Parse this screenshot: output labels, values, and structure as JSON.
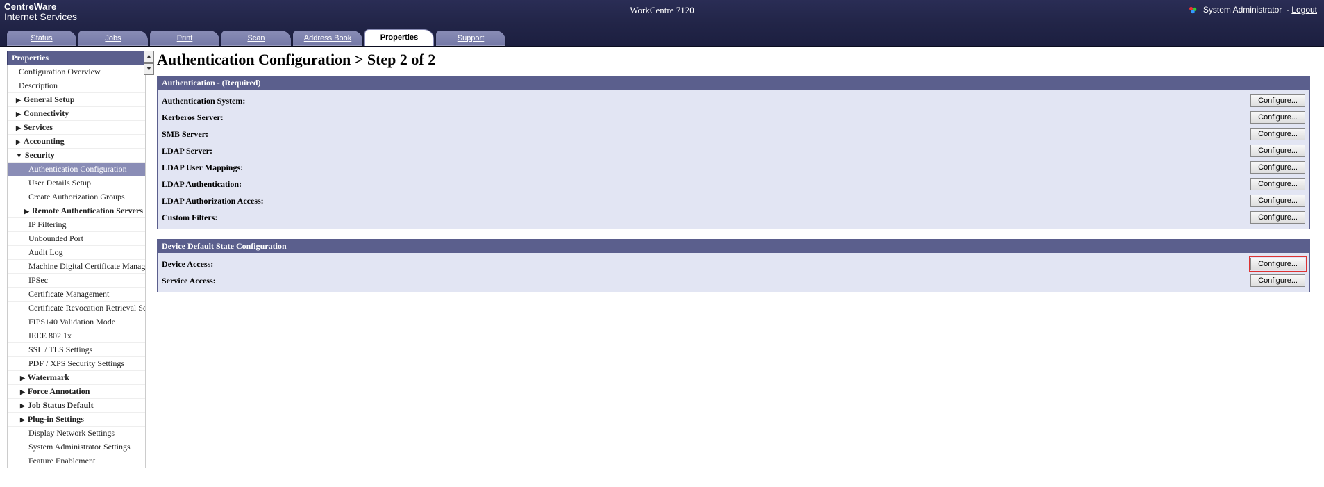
{
  "header": {
    "brand_top": "CentreWare",
    "brand_bottom": "Internet Services",
    "model": "WorkCentre 7120",
    "user_label": "System Administrator",
    "logout_label": "Logout"
  },
  "tabs": [
    {
      "label": "Status",
      "active": false
    },
    {
      "label": "Jobs",
      "active": false
    },
    {
      "label": "Print",
      "active": false
    },
    {
      "label": "Scan",
      "active": false
    },
    {
      "label": "Address Book",
      "active": false
    },
    {
      "label": "Properties",
      "active": true
    },
    {
      "label": "Support",
      "active": false
    }
  ],
  "sidebar": {
    "title": "Properties",
    "items": [
      {
        "label": "Configuration Overview",
        "type": "item"
      },
      {
        "label": "Description",
        "type": "item"
      },
      {
        "label": "General Setup",
        "type": "group",
        "open": false
      },
      {
        "label": "Connectivity",
        "type": "group",
        "open": false
      },
      {
        "label": "Services",
        "type": "group",
        "open": false
      },
      {
        "label": "Accounting",
        "type": "group",
        "open": false
      },
      {
        "label": "Security",
        "type": "group",
        "open": true
      },
      {
        "label": "Authentication Configuration",
        "type": "sub",
        "selected": true
      },
      {
        "label": "User Details Setup",
        "type": "sub"
      },
      {
        "label": "Create Authorization Groups",
        "type": "sub"
      },
      {
        "label": "Remote Authentication Servers",
        "type": "sub-group",
        "open": false
      },
      {
        "label": "IP Filtering",
        "type": "sub"
      },
      {
        "label": "Unbounded Port",
        "type": "sub"
      },
      {
        "label": "Audit Log",
        "type": "sub"
      },
      {
        "label": "Machine Digital Certificate Management",
        "type": "sub"
      },
      {
        "label": "IPSec",
        "type": "sub"
      },
      {
        "label": "Certificate Management",
        "type": "sub"
      },
      {
        "label": "Certificate Revocation Retrieval Settings",
        "type": "sub"
      },
      {
        "label": "FIPS140 Validation Mode",
        "type": "sub"
      },
      {
        "label": "IEEE 802.1x",
        "type": "sub"
      },
      {
        "label": "SSL / TLS Settings",
        "type": "sub"
      },
      {
        "label": "PDF / XPS Security Settings",
        "type": "sub"
      },
      {
        "label": "Watermark",
        "type": "group",
        "open": false,
        "indent": true
      },
      {
        "label": "Force Annotation",
        "type": "group",
        "open": false,
        "indent": true
      },
      {
        "label": "Job Status Default",
        "type": "group",
        "open": false,
        "indent": true
      },
      {
        "label": "Plug-in Settings",
        "type": "group",
        "open": false,
        "indent": true
      },
      {
        "label": "Display Network Settings",
        "type": "sub"
      },
      {
        "label": "System Administrator Settings",
        "type": "sub"
      },
      {
        "label": "Feature Enablement",
        "type": "sub"
      }
    ]
  },
  "main": {
    "title": "Authentication Configuration > Step 2 of 2",
    "configure_label": "Configure...",
    "panel1": {
      "title": "Authentication - (Required)",
      "rows": [
        "Authentication System:",
        "Kerberos Server:",
        "SMB Server:",
        "LDAP Server:",
        "LDAP User Mappings:",
        "LDAP Authentication:",
        "LDAP Authorization Access:",
        "Custom Filters:"
      ]
    },
    "panel2": {
      "title": "Device Default State Configuration",
      "rows": [
        {
          "label": "Device Access:",
          "highlight": true
        },
        {
          "label": "Service Access:",
          "highlight": false
        }
      ]
    }
  }
}
